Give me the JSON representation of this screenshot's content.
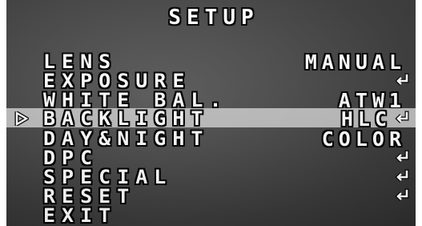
{
  "title": "SETUP",
  "menu": {
    "items": [
      {
        "label": "LENS",
        "value": "MANUAL",
        "enter": false,
        "selected": false
      },
      {
        "label": "EXPOSURE",
        "value": "",
        "enter": true,
        "selected": false
      },
      {
        "label": "WHITE BAL.",
        "value": "ATW1",
        "enter": false,
        "selected": false
      },
      {
        "label": "BACKLIGHT",
        "value": "HLC",
        "enter": true,
        "selected": true
      },
      {
        "label": "DAY&NIGHT",
        "value": "COLOR",
        "enter": false,
        "selected": false
      },
      {
        "label": "DPC",
        "value": "",
        "enter": true,
        "selected": false
      },
      {
        "label": "SPECIAL",
        "value": "",
        "enter": true,
        "selected": false
      },
      {
        "label": "RESET",
        "value": "",
        "enter": true,
        "selected": false
      },
      {
        "label": "EXIT",
        "value": "",
        "enter": false,
        "selected": false
      }
    ]
  },
  "icons": {
    "cursor": "selection-arrow-icon",
    "enter": "enter-return-icon"
  },
  "colors": {
    "text": "#ffffff",
    "outline": "#000000",
    "highlight": "#d7d7d7"
  }
}
